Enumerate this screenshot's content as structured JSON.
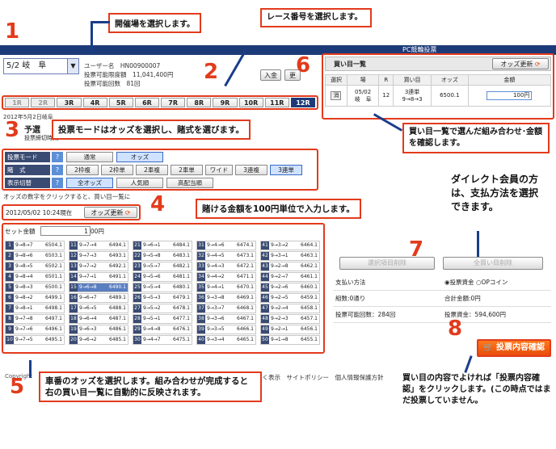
{
  "header": {
    "system_title": "PC競輪投票"
  },
  "venue": {
    "value": "5/2 岐　阜"
  },
  "user": {
    "name_line": "ユーザー名　HN00900007",
    "limit_line": "投票可能限度額　11,041,400円",
    "count_line": "投票可能回数　81回"
  },
  "buttons": {
    "deposit": "入金",
    "other": "更"
  },
  "races": [
    "1R",
    "2R",
    "3R",
    "4R",
    "5R",
    "6R",
    "7R",
    "8R",
    "9R",
    "10R",
    "11R",
    "12R"
  ],
  "race_info": {
    "date_line": "2012年5月2日岐阜",
    "sub1": "予選",
    "sub2": "投票締切時刻"
  },
  "mode": {
    "rows": [
      {
        "label": "投票モード",
        "q": "?",
        "options": [
          "通常",
          "オッズ"
        ],
        "selected": "オッズ"
      },
      {
        "label": "賭　式",
        "q": "?",
        "options": [
          "2枠複",
          "2枠単",
          "2車複",
          "2車単",
          "ワイド",
          "3連複",
          "3連単"
        ],
        "selected": "3連単"
      },
      {
        "label": "表示切替",
        "q": "?",
        "options": [
          "全オッズ",
          "人気順",
          "高配当順"
        ],
        "selected": "全オッズ"
      }
    ],
    "note": "オッズの数字をクリックすると、買い目一覧に"
  },
  "odds_time": {
    "timestamp": "2012/05/02 10:24現在",
    "update_label": "オッズ更新"
  },
  "odds_grid": {
    "set_label": "セット金額",
    "set_value": "1",
    "unit": "00円",
    "columns": [
      [
        [
          "1",
          "9→8→7",
          "6504.1"
        ],
        [
          "2",
          "9→8→6",
          "6503.1"
        ],
        [
          "3",
          "9→8→5",
          "6502.1"
        ],
        [
          "4",
          "9→8→4",
          "6501.1"
        ],
        [
          "5",
          "9→8→3",
          "6500.1"
        ],
        [
          "6",
          "9→8→2",
          "6499.1"
        ],
        [
          "7",
          "9→8→1",
          "6498.1"
        ],
        [
          "8",
          "9→7→8",
          "6497.1"
        ],
        [
          "9",
          "9→7→6",
          "6496.1"
        ],
        [
          "10",
          "9→7→5",
          "6495.1"
        ]
      ],
      [
        [
          "11",
          "9→7→4",
          "6494.1"
        ],
        [
          "12",
          "9→7→3",
          "6493.1"
        ],
        [
          "13",
          "9→7→2",
          "6492.1"
        ],
        [
          "14",
          "9→7→1",
          "6491.1"
        ],
        [
          "15",
          "9→6→8",
          "6490.1"
        ],
        [
          "16",
          "9→6→7",
          "6489.1"
        ],
        [
          "17",
          "9→6→5",
          "6488.1"
        ],
        [
          "18",
          "9→6→4",
          "6487.1"
        ],
        [
          "19",
          "9→6→3",
          "6486.1"
        ],
        [
          "20",
          "9→6→2",
          "6485.1"
        ]
      ],
      [
        [
          "21",
          "9→6→1",
          "6484.1"
        ],
        [
          "22",
          "9→5→8",
          "6483.1"
        ],
        [
          "23",
          "9→5→7",
          "6482.1"
        ],
        [
          "24",
          "9→5→6",
          "6481.1"
        ],
        [
          "25",
          "9→5→4",
          "6480.1"
        ],
        [
          "26",
          "9→5→3",
          "6479.1"
        ],
        [
          "27",
          "9→5→2",
          "6478.1"
        ],
        [
          "28",
          "9→5→1",
          "6477.1"
        ],
        [
          "29",
          "9→4→8",
          "6476.1"
        ],
        [
          "30",
          "9→4→7",
          "6475.1"
        ]
      ],
      [
        [
          "31",
          "9→4→6",
          "6474.1"
        ],
        [
          "32",
          "9→4→5",
          "6473.1"
        ],
        [
          "33",
          "9→4→3",
          "6472.1"
        ],
        [
          "34",
          "9→4→2",
          "6471.1"
        ],
        [
          "35",
          "9→4→1",
          "6470.1"
        ],
        [
          "36",
          "9→3→8",
          "6469.1"
        ],
        [
          "37",
          "9→3→7",
          "6468.1"
        ],
        [
          "38",
          "9→3→6",
          "6467.1"
        ],
        [
          "39",
          "9→3→5",
          "6466.1"
        ],
        [
          "40",
          "9→3→4",
          "6465.1"
        ]
      ],
      [
        [
          "41",
          "9→3→2",
          "6464.1"
        ],
        [
          "42",
          "9→3→1",
          "6463.1"
        ],
        [
          "43",
          "9→2→8",
          "6462.1"
        ],
        [
          "44",
          "9→2→7",
          "6461.1"
        ],
        [
          "45",
          "9→2→6",
          "6460.1"
        ],
        [
          "46",
          "9→2→5",
          "6459.1"
        ],
        [
          "47",
          "9→2→4",
          "6458.1"
        ],
        [
          "48",
          "9→2→3",
          "6457.1"
        ],
        [
          "49",
          "9→2→1",
          "6456.1"
        ],
        [
          "50",
          "9→1→8",
          "6455.1"
        ]
      ]
    ],
    "highlight": "15"
  },
  "cart": {
    "title": "買い目一覧",
    "update_label": "オッズ更新",
    "headers": [
      "選択",
      "場",
      "R",
      "買い目",
      "オッズ",
      "金額"
    ],
    "row": {
      "select": "消",
      "venue": "05/02\n岐　阜",
      "race": "12",
      "bet": "3連単\n9→8→3",
      "odds": "6500.1",
      "amount": "100円"
    }
  },
  "cart_buttons": {
    "clear_selected": "選択項目削除",
    "clear_all": "全買い目削除"
  },
  "payment": {
    "method_label": "支払い方法",
    "radio1": "投票資金",
    "radio2": "OPコイン",
    "count_label": "組数:0通り",
    "total_label": "合計金額:0円",
    "remain_label": "投票可能回数：284回",
    "funds_label": "投票資金：594,600円"
  },
  "confirm_label": "投票内容確認",
  "footer": {
    "links": "に基づく表示　サイトポリシー　個人情報保護方針",
    "copyright": "Copyright"
  },
  "callouts": {
    "c1": "開催場を選択します。",
    "c2": "レース番号を選択します。",
    "c3": "投票モードはオッズを選択し、賭式を選びます。",
    "c4": "賭ける金額を100円単位で入力します。",
    "c5": "車番のオッズを選択します。組み合わせが完成すると右の買い目一覧に自動的に反映されます。",
    "c6": "買い目一覧で選んだ組み合わせ･金額を確認します。",
    "c7": "ダイレクト会員の方は、支払方法を選択できます。",
    "c8": "買い目の内容でよければ「投票内容確認」をクリックします。(この時点ではまだ投票していません。"
  },
  "numbers": [
    "1",
    "2",
    "3",
    "4",
    "5",
    "6",
    "7",
    "8"
  ]
}
